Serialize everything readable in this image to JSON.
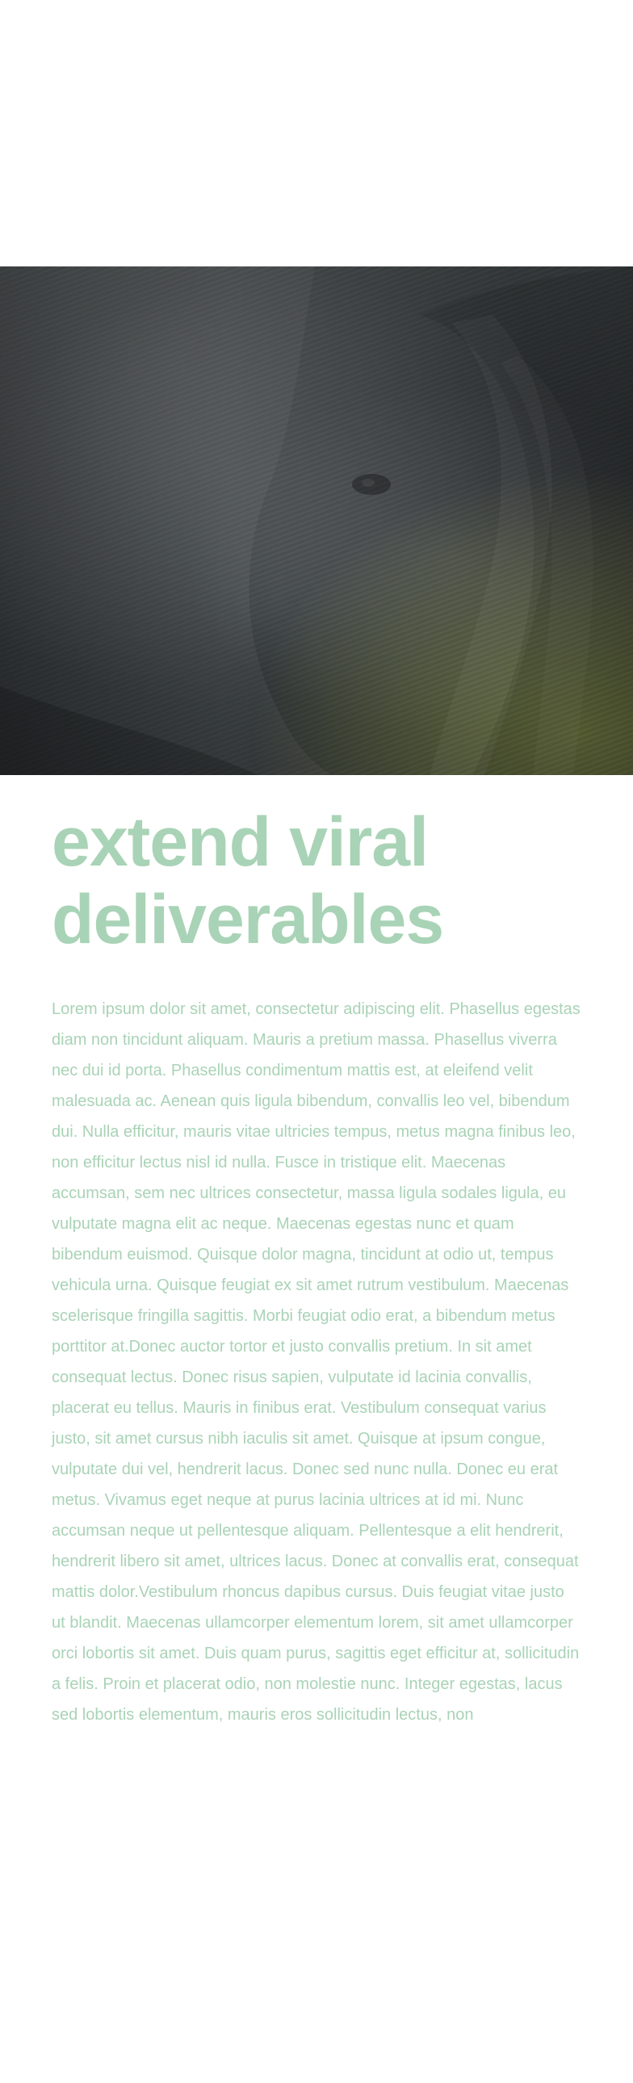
{
  "hero": {
    "image_icon": "elephant-photo"
  },
  "article": {
    "headline": "extend viral deliverables",
    "body": "Lorem ipsum dolor sit amet, consectetur adipiscing elit. Phasellus egestas diam non tincidunt aliquam. Mauris a pretium massa. Phasellus viverra nec dui id porta. Phasellus condimentum mattis est, at eleifend velit malesuada ac. Aenean quis ligula bibendum, convallis leo vel, bibendum dui. Nulla efficitur, mauris vitae ultricies tempus, metus magna finibus leo, non efficitur lectus nisl id nulla. Fusce in tristique elit. Maecenas accumsan, sem nec ultrices consectetur, massa ligula sodales ligula, eu vulputate magna elit ac neque. Maecenas egestas nunc et quam bibendum euismod. Quisque dolor magna, tincidunt at odio ut, tempus vehicula urna. Quisque feugiat ex sit amet rutrum vestibulum. Maecenas scelerisque fringilla sagittis. Morbi feugiat odio erat, a bibendum metus porttitor at.Donec auctor tortor et justo convallis pretium. In sit amet consequat lectus. Donec risus sapien, vulputate id lacinia convallis, placerat eu tellus. Mauris in finibus erat. Vestibulum consequat varius justo, sit amet cursus nibh iaculis sit amet. Quisque at ipsum congue, vulputate dui vel, hendrerit lacus. Donec sed nunc nulla. Donec eu erat metus. Vivamus eget neque at purus lacinia ultrices at id mi. Nunc accumsan neque ut pellentesque aliquam. Pellentesque a elit hendrerit, hendrerit libero sit amet, ultrices lacus. Donec at convallis erat, consequat mattis dolor.Vestibulum rhoncus dapibus cursus. Duis feugiat vitae justo ut blandit. Maecenas ullamcorper elementum lorem, sit amet ullamcorper orci lobortis sit amet. Duis quam purus, sagittis eget efficitur at, sollicitudin a felis. Proin et placerat odio, non molestie nunc. Integer egestas, lacus sed lobortis elementum, mauris eros sollicitudin lectus, non"
  },
  "colors": {
    "text_accent": "#a9d3b6",
    "background": "#ffffff"
  }
}
